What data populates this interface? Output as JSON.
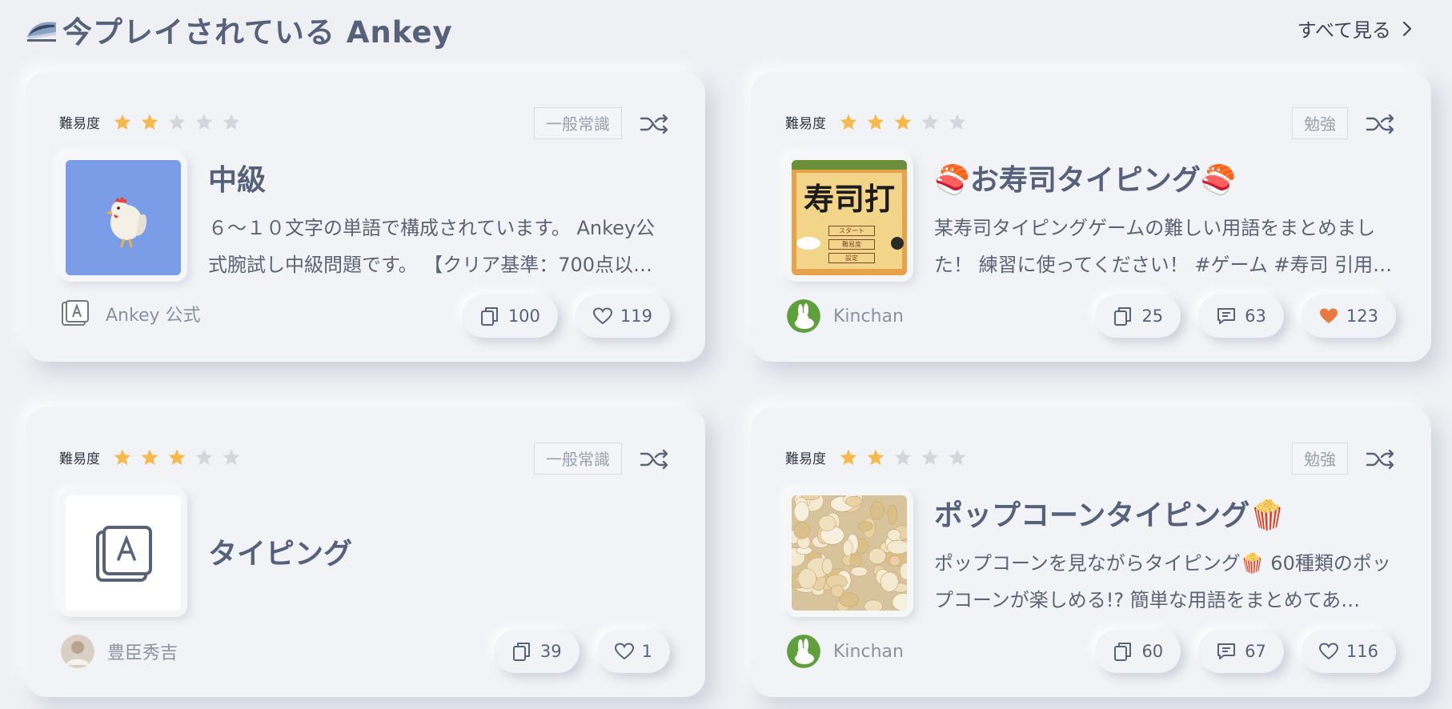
{
  "header": {
    "title": "今プレイされている Ankey",
    "see_all": "すべて見る"
  },
  "difficulty_label": "難易度",
  "cards": [
    {
      "difficulty": 2,
      "tag": "一般常識",
      "title": "中級",
      "description": "６〜１０文字の単語で構成されています。 Ankey公式腕試し中級問題です。 【クリア基準：700点以…",
      "author": "Ankey 公式",
      "copies": "100",
      "likes": "119",
      "thumb_icon": "rooster-icon",
      "thumb_bg": "#7b9de8"
    },
    {
      "difficulty": 3,
      "tag": "勉強",
      "title": "🍣お寿司タイピング🍣",
      "description": "某寿司タイピングゲームの難しい用語をまとめました！ 練習に使ってください！ #ゲーム #寿司 引用…",
      "author": "Kinchan",
      "copies": "25",
      "comments": "63",
      "likes": "123",
      "liked": true,
      "thumb_text": "寿司打",
      "thumb_buttons": [
        "スタート",
        "難易度",
        "設定"
      ]
    },
    {
      "difficulty": 3,
      "tag": "一般常識",
      "title": "タイピング",
      "description": "",
      "author": "豊臣秀吉",
      "copies": "39",
      "likes": "1",
      "thumb_icon": "ankey-key-icon"
    },
    {
      "difficulty": 2,
      "tag": "勉強",
      "title": "ポップコーンタイピング🍿",
      "description": "ポップコーンを見ながらタイピング🍿 60種類のポップコーンが楽しめる!? 簡単な用語をまとめてあ…",
      "author": "Kinchan",
      "copies": "60",
      "comments": "67",
      "likes": "116",
      "thumb_icon": "popcorn-photo"
    }
  ],
  "colors": {
    "background": "#eef0f4",
    "card": "#f2f3f6",
    "star_filled": "#f6b94a",
    "star_empty": "#d3d6dd",
    "heart_liked": "#e87a3e",
    "text": "#56617a"
  }
}
